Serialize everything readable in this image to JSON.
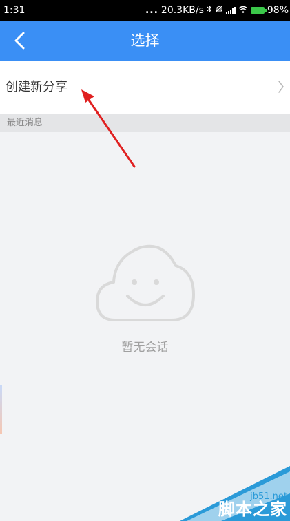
{
  "status_bar": {
    "time": "1:31",
    "dots": "...",
    "network_speed": "20.3KB/s",
    "battery_percent": "98%",
    "battery_level": 0.98
  },
  "header": {
    "title": "选择",
    "back_icon": "chevron-left-icon"
  },
  "create_share": {
    "label": "创建新分享",
    "chevron_icon": "chevron-right-icon"
  },
  "recent": {
    "section_label": "最近消息",
    "empty_icon": "cloud-smile-icon",
    "empty_text": "暂无会话"
  },
  "watermark": {
    "site": "jb51.net",
    "brand": "脚本之家"
  },
  "colors": {
    "accent": "#3a8ff5",
    "annotation": "#e02020",
    "background": "#f2f3f5"
  }
}
